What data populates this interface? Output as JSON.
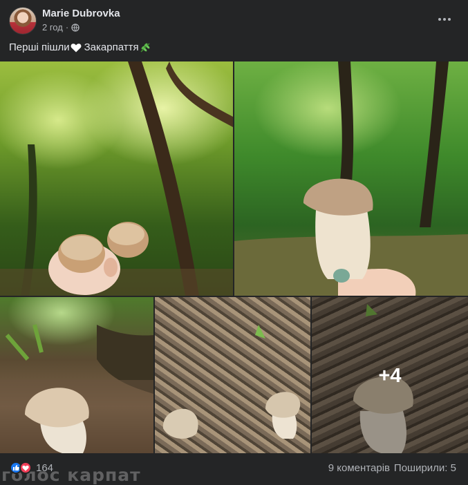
{
  "post": {
    "author": "Marie Dubrovka",
    "time": "2 год",
    "separator": "·",
    "caption_before": "Перші пішли",
    "caption_after": " Закарпаття",
    "icons": {
      "avatar": "profile-photo",
      "privacy": "globe-icon",
      "menu": "more-options-icon"
    }
  },
  "photos": {
    "more_count": "+4"
  },
  "footer": {
    "reaction_count": "164",
    "comments": "9 коментарів",
    "shares": "Поширили: 5",
    "watermark": "голос карпат"
  },
  "colors": {
    "background": "#242526",
    "text": "#e4e6eb",
    "secondary": "#b0b3b8",
    "like": "#1877f2",
    "love": "#f33e58"
  }
}
